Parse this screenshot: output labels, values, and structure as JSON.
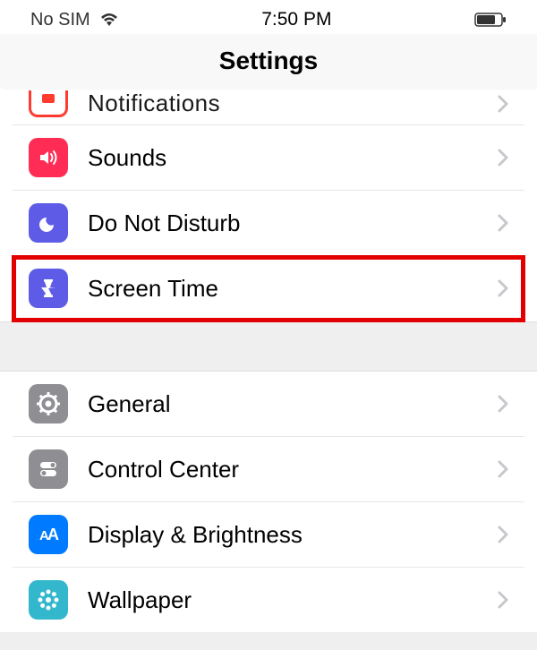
{
  "statusbar": {
    "carrier": "No SIM",
    "time": "7:50 PM"
  },
  "header": {
    "title": "Settings"
  },
  "groups": [
    {
      "items": [
        {
          "label": "Notifications",
          "icon": "notifications-icon",
          "color": "#FF3B30",
          "partial": true
        },
        {
          "label": "Sounds",
          "icon": "sounds-icon",
          "color": "#FF2D55"
        },
        {
          "label": "Do Not Disturb",
          "icon": "dnd-icon",
          "color": "#5E5CE6"
        },
        {
          "label": "Screen Time",
          "icon": "screentime-icon",
          "color": "#5E5CE6",
          "highlighted": true
        }
      ]
    },
    {
      "items": [
        {
          "label": "General",
          "icon": "general-icon",
          "color": "#8E8E93"
        },
        {
          "label": "Control Center",
          "icon": "controlcenter-icon",
          "color": "#8E8E93"
        },
        {
          "label": "Display & Brightness",
          "icon": "display-icon",
          "color": "#007AFF"
        },
        {
          "label": "Wallpaper",
          "icon": "wallpaper-icon",
          "color": "#33B7CC"
        }
      ]
    }
  ]
}
